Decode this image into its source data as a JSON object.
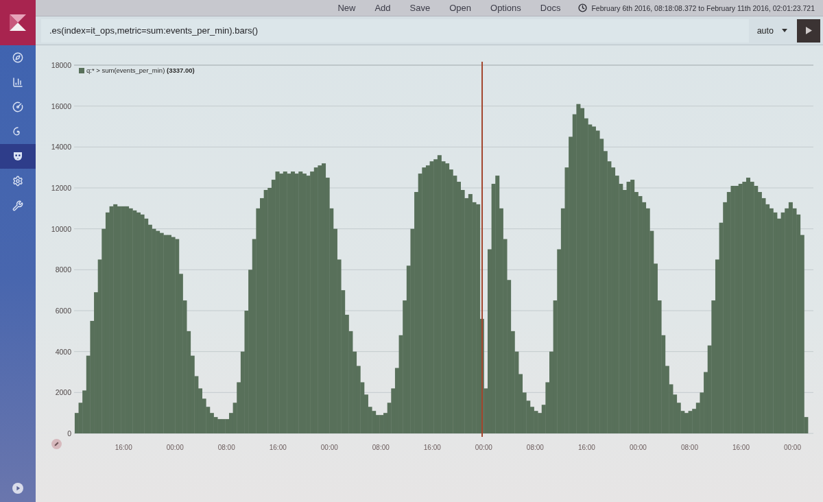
{
  "sidebar": {
    "items": [
      {
        "selected": false
      },
      {
        "selected": false
      },
      {
        "selected": false
      },
      {
        "selected": false
      },
      {
        "selected": true
      },
      {
        "selected": false
      },
      {
        "selected": false
      }
    ]
  },
  "menu": [
    "New",
    "Add",
    "Save",
    "Open",
    "Options",
    "Docs"
  ],
  "time_range": "February 6th 2016, 08:18:08.372 to February 11th 2016, 02:01:23.721",
  "query": {
    "value": ".es(index=it_ops,metric=sum:events_per_min).bars()"
  },
  "interval": {
    "value": "auto"
  },
  "chart": {
    "legend_value": "(3337.00)",
    "chart_data": {
      "type": "bar",
      "x": [
        "2016-02-06T08:24",
        "2016-02-06T09:00",
        "2016-02-06T09:36",
        "2016-02-06T10:12",
        "2016-02-06T10:48",
        "2016-02-06T11:24",
        "2016-02-06T12:00",
        "2016-02-06T12:36",
        "2016-02-06T13:12",
        "2016-02-06T13:48",
        "2016-02-06T14:24",
        "2016-02-06T15:00",
        "2016-02-06T15:36",
        "2016-02-06T16:12",
        "2016-02-06T16:48",
        "2016-02-06T17:24",
        "2016-02-06T18:00",
        "2016-02-06T18:36",
        "2016-02-06T19:12",
        "2016-02-06T19:48",
        "2016-02-06T20:24",
        "2016-02-06T21:00",
        "2016-02-06T21:36",
        "2016-02-06T22:12",
        "2016-02-06T22:48",
        "2016-02-06T23:24",
        "2016-02-07T00:00",
        "2016-02-07T00:36",
        "2016-02-07T01:12",
        "2016-02-07T01:48",
        "2016-02-07T02:24",
        "2016-02-07T03:00",
        "2016-02-07T03:36",
        "2016-02-07T04:12",
        "2016-02-07T04:48",
        "2016-02-07T05:24",
        "2016-02-07T06:00",
        "2016-02-07T06:36",
        "2016-02-07T07:12",
        "2016-02-07T07:48",
        "2016-02-07T08:24",
        "2016-02-07T09:00",
        "2016-02-07T09:36",
        "2016-02-07T10:12",
        "2016-02-07T10:48",
        "2016-02-07T11:24",
        "2016-02-07T12:00",
        "2016-02-07T12:36",
        "2016-02-07T13:12",
        "2016-02-07T13:48",
        "2016-02-07T14:24",
        "2016-02-07T15:00",
        "2016-02-07T15:36",
        "2016-02-07T16:12",
        "2016-02-07T16:48",
        "2016-02-07T17:24",
        "2016-02-07T18:00",
        "2016-02-07T18:36",
        "2016-02-07T19:12",
        "2016-02-07T19:48",
        "2016-02-07T20:24",
        "2016-02-07T21:00",
        "2016-02-07T21:36",
        "2016-02-07T22:12",
        "2016-02-07T22:48",
        "2016-02-07T23:24",
        "2016-02-08T00:00",
        "2016-02-08T00:36",
        "2016-02-08T01:12",
        "2016-02-08T01:48",
        "2016-02-08T02:24",
        "2016-02-08T03:00",
        "2016-02-08T03:36",
        "2016-02-08T04:12",
        "2016-02-08T04:48",
        "2016-02-08T05:24",
        "2016-02-08T06:00",
        "2016-02-08T06:36",
        "2016-02-08T07:12",
        "2016-02-08T07:48",
        "2016-02-08T08:24",
        "2016-02-08T09:00",
        "2016-02-08T09:36",
        "2016-02-08T10:12",
        "2016-02-08T10:48",
        "2016-02-08T11:24",
        "2016-02-08T12:00",
        "2016-02-08T12:36",
        "2016-02-08T13:12",
        "2016-02-08T13:48",
        "2016-02-08T14:24",
        "2016-02-08T15:00",
        "2016-02-08T15:36",
        "2016-02-08T16:12",
        "2016-02-08T16:48",
        "2016-02-08T17:24",
        "2016-02-08T18:00",
        "2016-02-08T18:36",
        "2016-02-08T19:12",
        "2016-02-08T19:48",
        "2016-02-08T20:24",
        "2016-02-08T21:00",
        "2016-02-08T21:36",
        "2016-02-08T22:12",
        "2016-02-08T22:48",
        "2016-02-08T23:24",
        "2016-02-09T00:00",
        "2016-02-09T00:36",
        "2016-02-09T01:12",
        "2016-02-09T01:48",
        "2016-02-09T02:24",
        "2016-02-09T03:00",
        "2016-02-09T03:36",
        "2016-02-09T04:12",
        "2016-02-09T04:48",
        "2016-02-09T05:24",
        "2016-02-09T06:00",
        "2016-02-09T06:36",
        "2016-02-09T07:12",
        "2016-02-09T07:48",
        "2016-02-09T08:24",
        "2016-02-09T09:00",
        "2016-02-09T09:36",
        "2016-02-09T10:12",
        "2016-02-09T10:48",
        "2016-02-09T11:24",
        "2016-02-09T12:00",
        "2016-02-09T12:36",
        "2016-02-09T13:12",
        "2016-02-09T13:48",
        "2016-02-09T14:24",
        "2016-02-09T15:00",
        "2016-02-09T15:36",
        "2016-02-09T16:12",
        "2016-02-09T16:48",
        "2016-02-09T17:24",
        "2016-02-09T18:00",
        "2016-02-09T18:36",
        "2016-02-09T19:12",
        "2016-02-09T19:48",
        "2016-02-09T20:24",
        "2016-02-09T21:00",
        "2016-02-09T21:36",
        "2016-02-09T22:12",
        "2016-02-09T22:48",
        "2016-02-09T23:24",
        "2016-02-10T00:00",
        "2016-02-10T00:36",
        "2016-02-10T01:12",
        "2016-02-10T01:48",
        "2016-02-10T02:24",
        "2016-02-10T03:00",
        "2016-02-10T03:36",
        "2016-02-10T04:12",
        "2016-02-10T04:48",
        "2016-02-10T05:24",
        "2016-02-10T06:00",
        "2016-02-10T06:36",
        "2016-02-10T07:12",
        "2016-02-10T07:48",
        "2016-02-10T08:24",
        "2016-02-10T09:00",
        "2016-02-10T09:36",
        "2016-02-10T10:12",
        "2016-02-10T10:48",
        "2016-02-10T11:24",
        "2016-02-10T12:00",
        "2016-02-10T12:36",
        "2016-02-10T13:12",
        "2016-02-10T13:48",
        "2016-02-10T14:24",
        "2016-02-10T15:00",
        "2016-02-10T15:36",
        "2016-02-10T16:12",
        "2016-02-10T16:48",
        "2016-02-10T17:24",
        "2016-02-10T18:00",
        "2016-02-10T18:36",
        "2016-02-10T19:12",
        "2016-02-10T19:48",
        "2016-02-10T20:24",
        "2016-02-10T21:00",
        "2016-02-10T21:36",
        "2016-02-10T22:12",
        "2016-02-10T22:48",
        "2016-02-10T23:24",
        "2016-02-11T00:00",
        "2016-02-11T00:36",
        "2016-02-11T01:12",
        "2016-02-11T01:48"
      ],
      "series": [
        {
          "name": "q:* > sum(events_per_min)",
          "color": "#58705a",
          "values": [
            1000,
            1500,
            2100,
            3800,
            5500,
            6900,
            8500,
            10000,
            10800,
            11100,
            11200,
            11100,
            11100,
            11100,
            11000,
            10900,
            10800,
            10700,
            10500,
            10200,
            10000,
            9900,
            9800,
            9700,
            9700,
            9600,
            9500,
            7800,
            6500,
            5000,
            3800,
            2800,
            2200,
            1700,
            1300,
            1000,
            800,
            700,
            700,
            700,
            1000,
            1500,
            2500,
            4000,
            6000,
            8000,
            9500,
            11000,
            11500,
            11900,
            12000,
            12400,
            12800,
            12700,
            12800,
            12700,
            12800,
            12700,
            12800,
            12700,
            12600,
            12800,
            13000,
            13100,
            13200,
            12500,
            11000,
            10000,
            8500,
            7000,
            5800,
            5000,
            4000,
            3300,
            2500,
            1900,
            1300,
            1100,
            900,
            900,
            1000,
            1500,
            2200,
            3200,
            4800,
            6500,
            8200,
            10000,
            11800,
            12700,
            13000,
            13100,
            13300,
            13400,
            13600,
            13300,
            13200,
            12900,
            12600,
            12300,
            11900,
            11500,
            11700,
            11300,
            11200,
            5600,
            2200,
            9000,
            12200,
            12600,
            11000,
            9500,
            7500,
            5000,
            4000,
            2900,
            2000,
            1600,
            1300,
            1100,
            1000,
            1400,
            2500,
            4000,
            6500,
            9000,
            11000,
            13000,
            14500,
            15600,
            16100,
            15900,
            15400,
            15100,
            15000,
            14800,
            14400,
            13800,
            13300,
            13000,
            12600,
            12200,
            11900,
            12300,
            12400,
            11800,
            11600,
            11300,
            11000,
            9900,
            8300,
            6500,
            4800,
            3300,
            2400,
            1900,
            1500,
            1100,
            1000,
            1100,
            1200,
            1500,
            2000,
            3000,
            4300,
            6500,
            8500,
            10300,
            11300,
            11800,
            12100,
            12100,
            12200,
            12300,
            12500,
            12300,
            12100,
            11800,
            11500,
            11200,
            11000,
            10800,
            10500,
            10800,
            11000,
            11300,
            11000,
            10700,
            9700,
            800
          ]
        }
      ],
      "xlim": [
        "2016-02-06T08:18:08.372",
        "2016-02-11T02:24"
      ],
      "ylim": [
        0,
        18000
      ],
      "xticks": [
        {
          "value": "2016-02-06T16:00",
          "label": "16:00"
        },
        {
          "value": "2016-02-07T00:00",
          "label": "00:00"
        },
        {
          "value": "2016-02-07T08:00",
          "label": "08:00"
        },
        {
          "value": "2016-02-07T16:00",
          "label": "16:00"
        },
        {
          "value": "2016-02-08T00:00",
          "label": "00:00"
        },
        {
          "value": "2016-02-08T08:00",
          "label": "08:00"
        },
        {
          "value": "2016-02-08T16:00",
          "label": "16:00"
        },
        {
          "value": "2016-02-09T00:00",
          "label": "00:00"
        },
        {
          "value": "2016-02-09T08:00",
          "label": "08:00"
        },
        {
          "value": "2016-02-09T16:00",
          "label": "16:00"
        },
        {
          "value": "2016-02-10T00:00",
          "label": "00:00"
        },
        {
          "value": "2016-02-10T08:00",
          "label": "08:00"
        },
        {
          "value": "2016-02-10T16:00",
          "label": "16:00"
        },
        {
          "value": "2016-02-11T00:00",
          "label": "00:00"
        }
      ],
      "yticks": [
        0,
        2000,
        4000,
        6000,
        8000,
        10000,
        12000,
        14000,
        16000,
        18000
      ],
      "grid": true,
      "ref_lines": [
        {
          "axis": "x",
          "value": "2016-02-08T23:45"
        }
      ]
    }
  }
}
